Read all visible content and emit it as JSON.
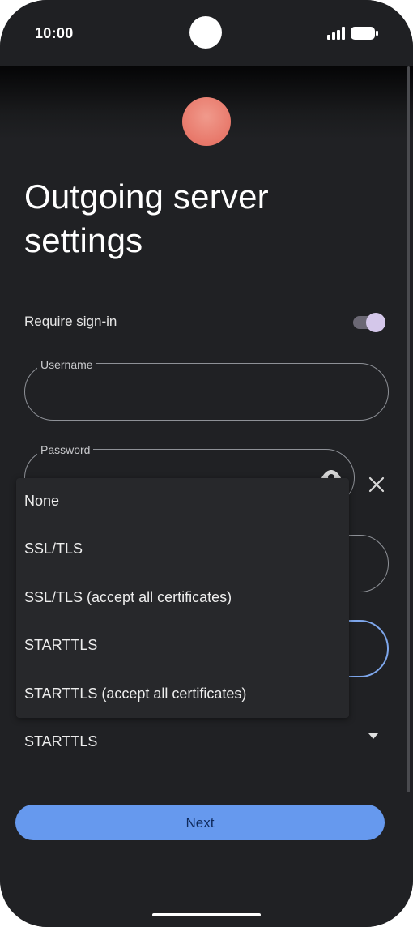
{
  "status_bar": {
    "time": "10:00",
    "icons": [
      "signal-icon",
      "battery-icon"
    ]
  },
  "header": {
    "title": "Outgoing server settings"
  },
  "require_signin": {
    "label": "Require sign-in",
    "enabled": true
  },
  "username": {
    "label": "Username",
    "value": ""
  },
  "password": {
    "label": "Password",
    "value": ""
  },
  "security_dropdown": {
    "options": [
      "None",
      "SSL/TLS",
      "SSL/TLS (accept all certificates)",
      "STARTTLS",
      "STARTTLS (accept all certificates)"
    ],
    "selected": "STARTTLS"
  },
  "next_button": {
    "label": "Next"
  },
  "colors": {
    "background": "#202124",
    "accent": "#6699ee",
    "toggle_knob": "#d4c7ea",
    "avatar": "#e8786a"
  }
}
